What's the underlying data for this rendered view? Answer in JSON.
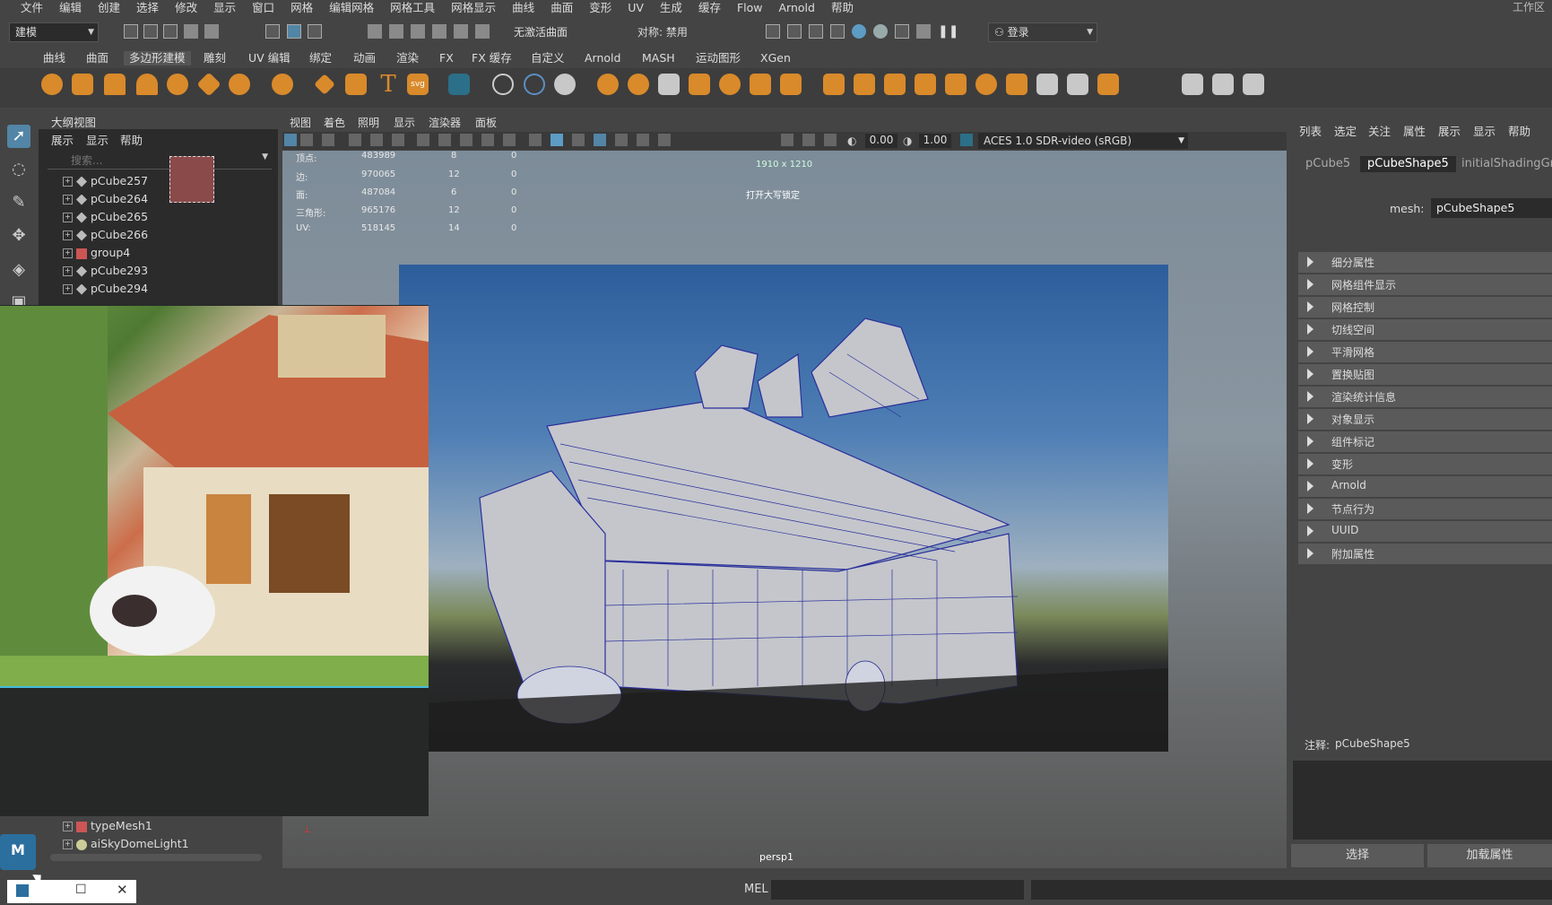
{
  "menubar": {
    "items": [
      "文件",
      "编辑",
      "创建",
      "选择",
      "修改",
      "显示",
      "窗口",
      "网格",
      "编辑网格",
      "网格工具",
      "网格显示",
      "曲线",
      "曲面",
      "变形",
      "UV",
      "生成",
      "缓存",
      "Flow",
      "Arnold",
      "帮助"
    ],
    "workspace": "工作区"
  },
  "toolbar": {
    "mode": "建模",
    "surface": "无激活曲面",
    "symmetry": "对称: 禁用",
    "login": "登录"
  },
  "shelf": {
    "tabs": [
      "曲线",
      "曲面",
      "多边形建模",
      "雕刻",
      "UV 编辑",
      "绑定",
      "动画",
      "渲染",
      "FX",
      "FX 缓存",
      "自定义",
      "Arnold",
      "MASH",
      "运动图形",
      "XGen"
    ],
    "selected_tab": "多边形建模"
  },
  "outliner": {
    "title": "大纲视图",
    "menu": [
      "展示",
      "显示",
      "帮助"
    ],
    "search_placeholder": "搜索...",
    "items": [
      "pCube257",
      "pCube264",
      "pCube265",
      "pCube266",
      "group4",
      "pCube293",
      "pCube294"
    ],
    "bottom_items": [
      "typeMesh1",
      "aiSkyDomeLight1"
    ]
  },
  "viewport": {
    "menu": [
      "视图",
      "着色",
      "照明",
      "显示",
      "渲染器",
      "面板"
    ],
    "exposure": "0.00",
    "gamma": "1.00",
    "color_space": "ACES 1.0 SDR-video (sRGB)",
    "resolution": "1910 x 1210",
    "capslock": "打开大写锁定",
    "camera": "persp1",
    "stats": [
      {
        "label": "顶点:",
        "a": "483989",
        "b": "8",
        "c": "0"
      },
      {
        "label": "边:",
        "a": "970065",
        "b": "12",
        "c": "0"
      },
      {
        "label": "面:",
        "a": "487084",
        "b": "6",
        "c": "0"
      },
      {
        "label": "三角形:",
        "a": "965176",
        "b": "12",
        "c": "0"
      },
      {
        "label": "UV:",
        "a": "518145",
        "b": "14",
        "c": "0"
      }
    ]
  },
  "attribute_editor": {
    "menu": [
      "列表",
      "选定",
      "关注",
      "属性",
      "展示",
      "显示",
      "帮助"
    ],
    "tabs": [
      "pCube5",
      "pCubeShape5",
      "initialShadingGro"
    ],
    "active_tab": "pCubeShape5",
    "mesh_label": "mesh:",
    "mesh_value": "pCubeShape5",
    "sections": [
      "细分属性",
      "网格组件显示",
      "网格控制",
      "切线空间",
      "平滑网格",
      "置换贴图",
      "渲染统计信息",
      "对象显示",
      "组件标记",
      "变形",
      "Arnold",
      "节点行为",
      "UUID",
      "附加属性"
    ],
    "notes_label": "注释:",
    "notes_value": "pCubeShape5",
    "select_button": "选择",
    "load_button": "加载属性"
  },
  "status": {
    "mel": "MEL"
  },
  "colors": {
    "panel": "#444444",
    "dark": "#2b2b2b",
    "highlight": "#5285a6"
  }
}
